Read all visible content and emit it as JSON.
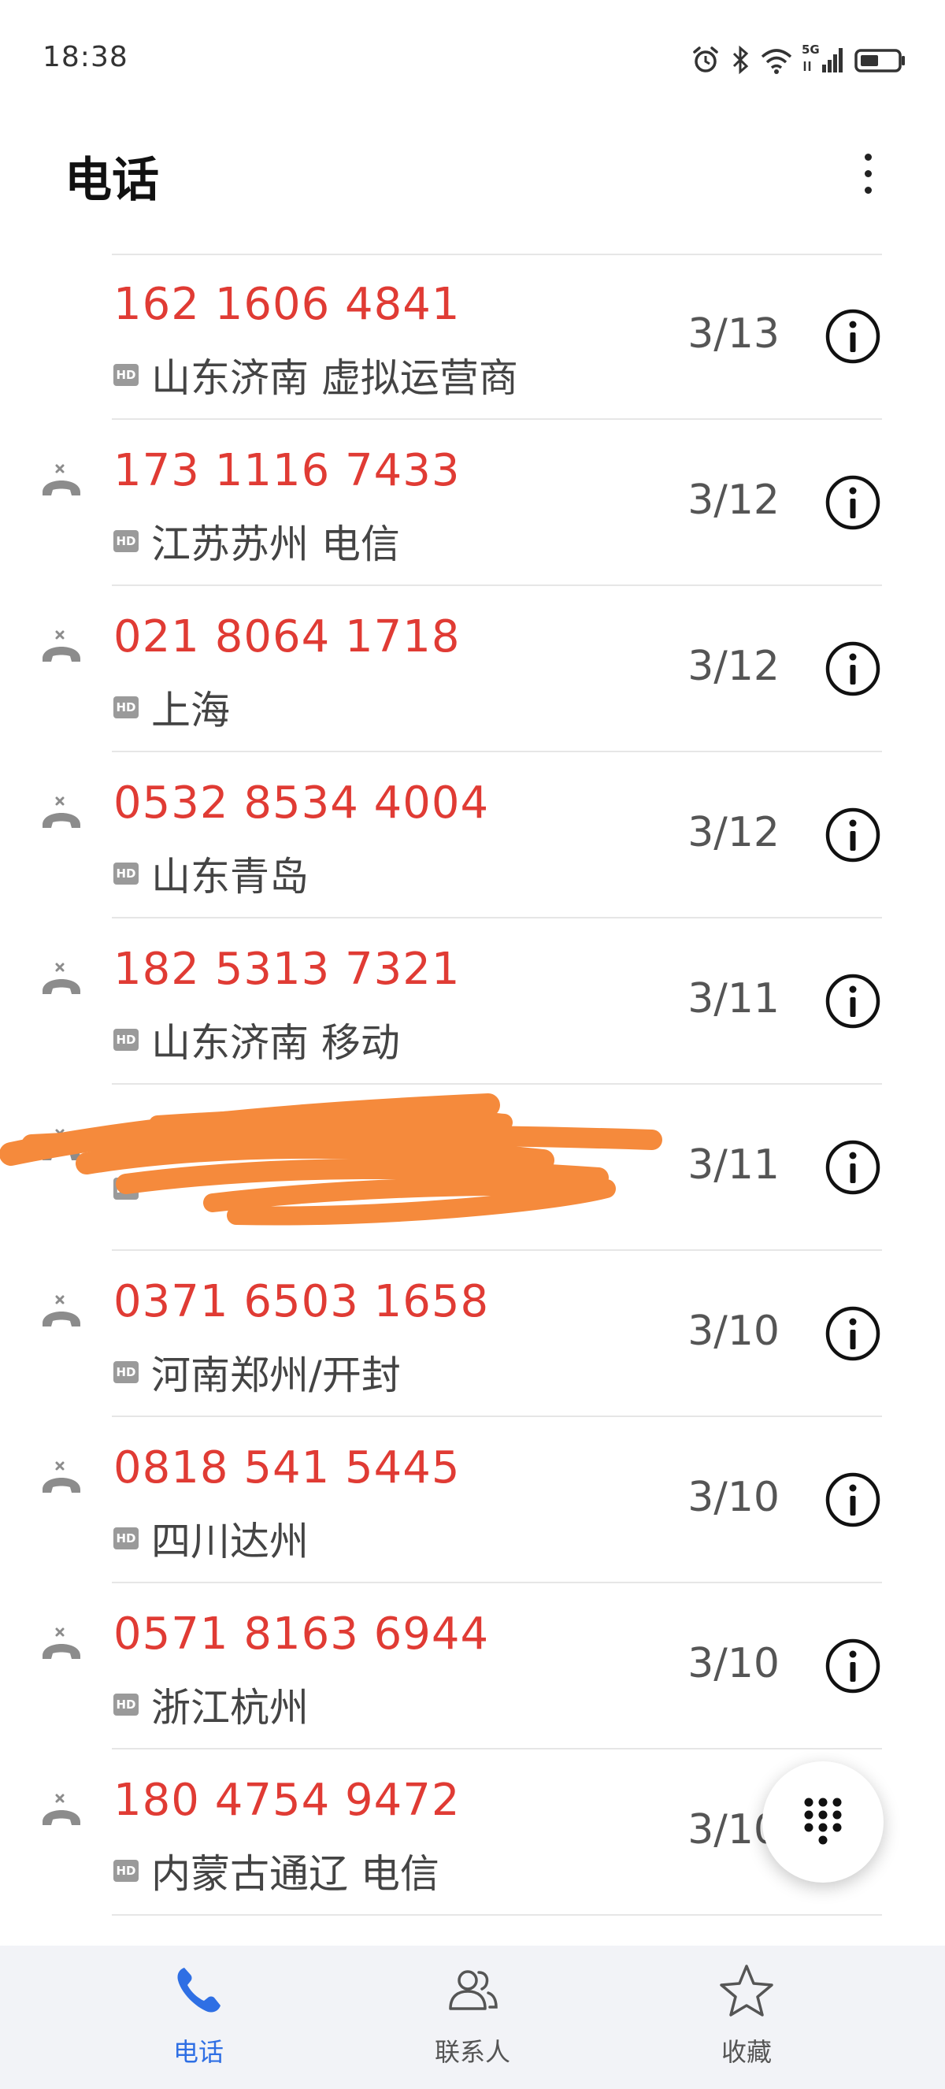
{
  "status_bar": {
    "time": "18:38",
    "network_label": "5G"
  },
  "header": {
    "title": "电话"
  },
  "colors": {
    "missed_red": "#e03b34",
    "active_blue": "#2f6fe4",
    "scribble_orange": "#f58a3c"
  },
  "calls": [
    {
      "number": "162 1606 4841",
      "location": "山东济南 虚拟运营商",
      "date": "3/13",
      "missed_icon": false,
      "hd": "HD"
    },
    {
      "number": "173 1116 7433",
      "location": "江苏苏州 电信",
      "date": "3/12",
      "missed_icon": true,
      "hd": "HD"
    },
    {
      "number": "021 8064 1718",
      "location": "上海",
      "date": "3/12",
      "missed_icon": true,
      "hd": "HD"
    },
    {
      "number": "0532 8534 4004",
      "location": "山东青岛",
      "date": "3/12",
      "missed_icon": true,
      "hd": "HD"
    },
    {
      "number": "182 5313 7321",
      "location": "山东济南 移动",
      "date": "3/11",
      "missed_icon": true,
      "hd": "HD"
    },
    {
      "number": "",
      "location": "",
      "date": "3/11",
      "missed_icon": true,
      "hd": "HD",
      "redacted": true
    },
    {
      "number": "0371 6503 1658",
      "location": "河南郑州/开封",
      "date": "3/10",
      "missed_icon": true,
      "hd": "HD"
    },
    {
      "number": "0818 541 5445",
      "location": "四川达州",
      "date": "3/10",
      "missed_icon": true,
      "hd": "HD"
    },
    {
      "number": "0571 8163 6944",
      "location": "浙江杭州",
      "date": "3/10",
      "missed_icon": true,
      "hd": "HD"
    },
    {
      "number": "180 4754 9472",
      "location": "内蒙古通辽 电信",
      "date": "3/10",
      "missed_icon": true,
      "hd": "HD"
    }
  ],
  "bottom_nav": [
    {
      "label": "电话",
      "icon": "phone-icon",
      "active": true
    },
    {
      "label": "联系人",
      "icon": "contacts-icon",
      "active": false
    },
    {
      "label": "收藏",
      "icon": "star-icon",
      "active": false
    }
  ]
}
